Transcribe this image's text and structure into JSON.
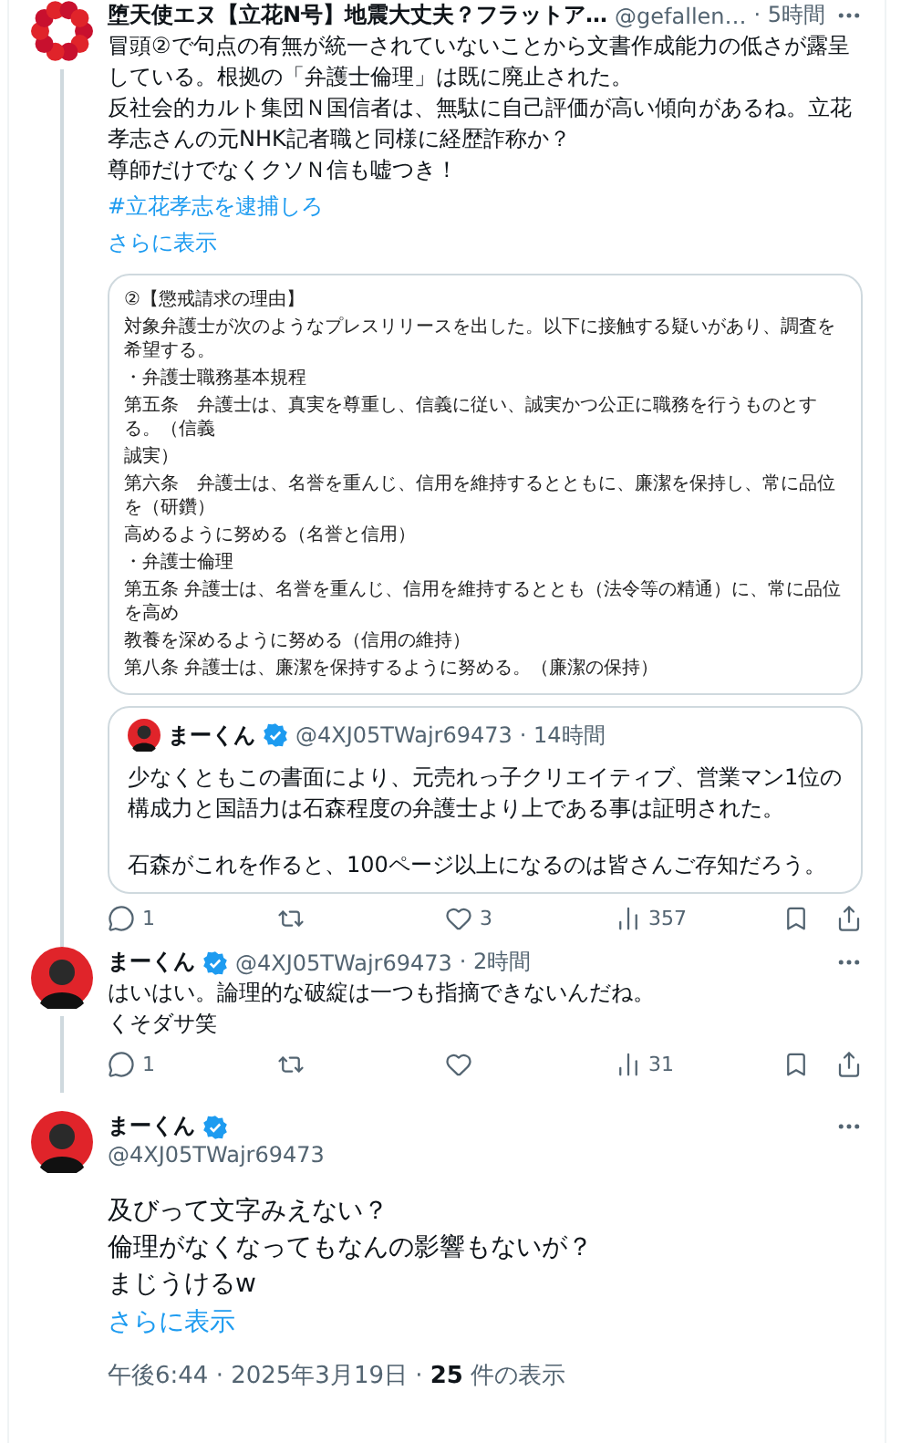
{
  "tweets": [
    {
      "kind": "reply",
      "avatar": {
        "kind": "ring"
      },
      "author": "堕天使エヌ【立花N号】地震大丈夫？フラットア…",
      "verified": false,
      "handle": "@gefallen…",
      "time": "· 5時間",
      "paragraphs": [
        "冒頭②で句点の有無が統一されていないことから文書作成能力の低さが露呈している。根拠の「弁護士倫理」は既に廃止された。",
        "反社会的カルト集団Ｎ国信者は、無駄に自己評価が高い傾向があるね。立花孝志さんの元NHK記者職と同様に経歴詐称か？",
        "尊師だけでなくクソＮ信も嘘つき！"
      ],
      "hashtag": "#立花孝志を逮捕しろ",
      "show_more": "さらに表示",
      "document": [
        "②【懲戒請求の理由】",
        "対象弁護士が次のようなプレスリリースを出した。以下に接触する疑いがあり、調査を希望する。",
        "・弁護士職務基本規程",
        "第五条　弁護士は、真実を尊重し、信義に従い、誠実かつ公正に職務を行うものとする。（信義",
        "誠実）",
        "第六条　弁護士は、名誉を重んじ、信用を維持するとともに、廉潔を保持し、常に品位を（研鑽）",
        "高めるように努める（名誉と信用）",
        "・弁護士倫理",
        "第五条  弁護士は、名誉を重んじ、信用を維持するととも（法令等の精通）に、常に品位を高め",
        "教養を深めるように努める（信用の維持）",
        "第八条  弁護士は、廉潔を保持するように努める。（廉潔の保持）"
      ],
      "quote": {
        "author": "まーくん",
        "verified": true,
        "handle": "@4XJ05TWajr69473",
        "time": "· 14時間",
        "paragraphs": [
          "少なくともこの書面により、元売れっ子クリエイティブ、営業マン1位の構成力と国語力は石森程度の弁護士より上である事は証明された。",
          "石森がこれを作ると、100ページ以上になるのは皆さんご存知だろう。"
        ]
      },
      "actions": [
        {
          "kind": "reply",
          "count": "1"
        },
        {
          "kind": "repost"
        },
        {
          "kind": "like",
          "count": "3"
        },
        {
          "kind": "views",
          "count": "357"
        },
        {
          "kind": "bookmark"
        },
        {
          "kind": "share"
        }
      ]
    },
    {
      "kind": "reply",
      "avatar": {
        "kind": "figure"
      },
      "author": "まーくん",
      "verified": true,
      "handle": "@4XJ05TWajr69473",
      "time": "· 2時間",
      "paragraphs": [
        "はいはい。論理的な破綻は一つも指摘できないんだね。",
        "くそダサ笑"
      ],
      "actions": [
        {
          "kind": "reply",
          "count": "1"
        },
        {
          "kind": "repost"
        },
        {
          "kind": "like"
        },
        {
          "kind": "views",
          "count": "31"
        },
        {
          "kind": "bookmark"
        },
        {
          "kind": "share"
        }
      ]
    },
    {
      "kind": "main",
      "avatar": {
        "kind": "figure"
      },
      "author": "まーくん",
      "verified": true,
      "handle": "@4XJ05TWajr69473",
      "paragraphs": [
        "及びって文字みえない？",
        "倫理がなくなってもなんの影響もないが？",
        "まじうけるw"
      ],
      "show_more": "さらに表示",
      "meta": {
        "time": "午後6:44 · 2025年3月19日 · ",
        "views": "25",
        "views_label": " 件の表示"
      }
    }
  ]
}
